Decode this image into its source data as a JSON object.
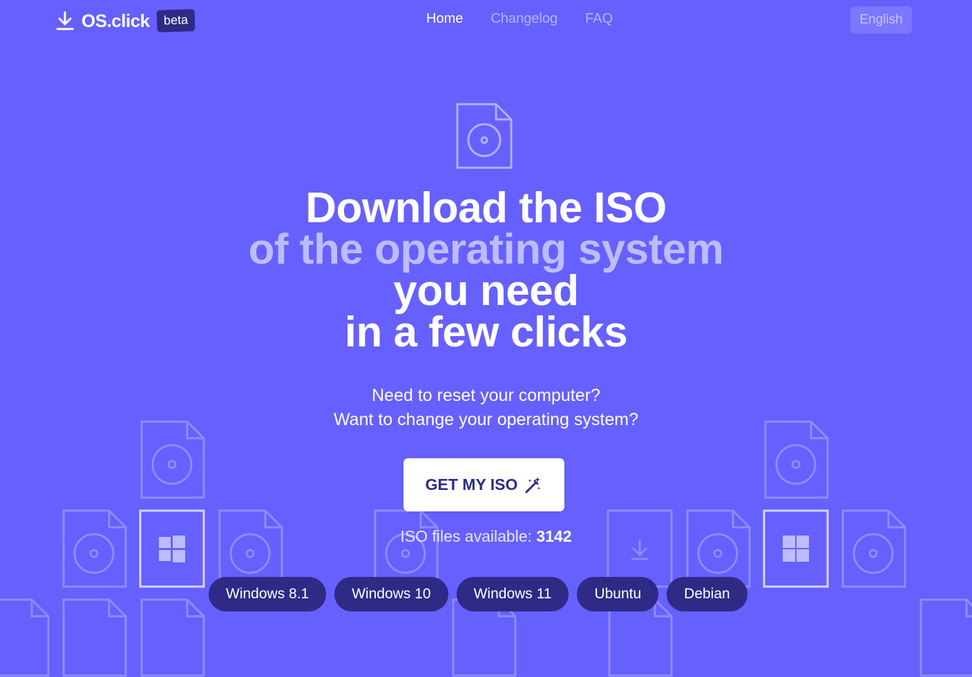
{
  "header": {
    "brand": "OS.click",
    "badge": "beta",
    "nav": [
      {
        "label": "Home",
        "active": true
      },
      {
        "label": "Changelog",
        "active": false
      },
      {
        "label": "FAQ",
        "active": false
      }
    ],
    "language": "English"
  },
  "hero": {
    "headline": {
      "line1": "Download the ISO",
      "line2": "of the operating system",
      "line3": "you need",
      "line4": "in a few clicks"
    },
    "subtitle": {
      "line1": "Need to reset your computer?",
      "line2": "Want to change your operating system?"
    },
    "cta_label": "GET MY ISO",
    "cta_icon": "magic-wand-icon",
    "count_label": "ISO files available: ",
    "count_value": "3142"
  },
  "os_chips": [
    "Windows 8.1",
    "Windows 10",
    "Windows 11",
    "Ubuntu",
    "Debian"
  ],
  "colors": {
    "background": "#6660ff",
    "chip": "#2f2a86",
    "headline_accent": "#bdbcff",
    "cta_text": "#2e2a8c"
  }
}
